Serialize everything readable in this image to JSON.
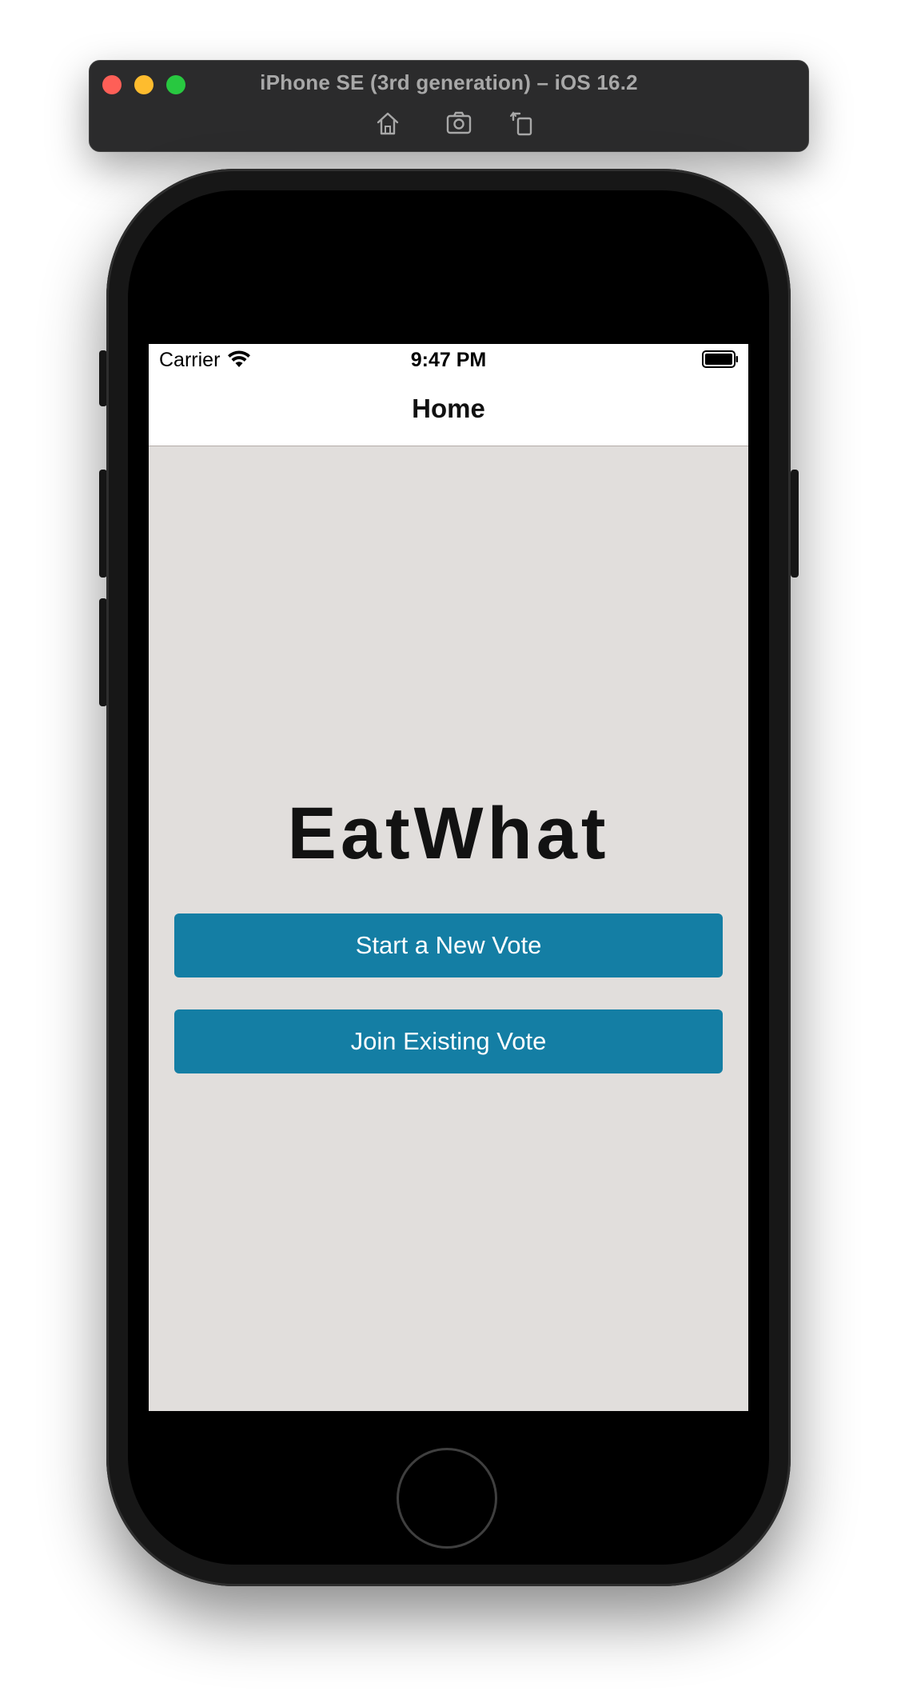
{
  "simulator": {
    "title": "iPhone SE (3rd generation) – iOS 16.2",
    "tools": [
      "home-icon",
      "screenshot-icon",
      "rotate-icon"
    ]
  },
  "status_bar": {
    "carrier": "Carrier",
    "time": "9:47 PM"
  },
  "nav": {
    "title": "Home"
  },
  "main": {
    "app_title": "EatWhat",
    "start_button": "Start a New Vote",
    "join_button": "Join Existing Vote"
  },
  "colors": {
    "accent": "#147ea4",
    "background": "#e1dedc",
    "nav_background": "#ffffff"
  }
}
